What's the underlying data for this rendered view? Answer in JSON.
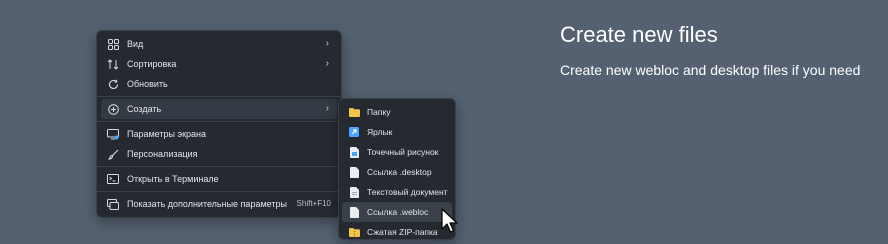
{
  "feature": {
    "title": "Create new files",
    "description": "Create new webloc and desktop files if you need"
  },
  "context_menu": {
    "items": [
      {
        "label": "Вид",
        "icon": "grid-icon",
        "has_submenu": true
      },
      {
        "label": "Сортировка",
        "icon": "sort-icon",
        "has_submenu": true
      },
      {
        "label": "Обновить",
        "icon": "refresh-icon",
        "has_submenu": false
      },
      {
        "label": "Создать",
        "icon": "plus-circle-icon",
        "has_submenu": true
      },
      {
        "label": "Параметры экрана",
        "icon": "display-icon",
        "has_submenu": false
      },
      {
        "label": "Персонализация",
        "icon": "brush-icon",
        "has_submenu": false
      },
      {
        "label": "Открыть в Терминале",
        "icon": "terminal-icon",
        "has_submenu": false
      },
      {
        "label": "Показать дополнительные параметры",
        "icon": "more-options-icon",
        "shortcut": "Shift+F10"
      }
    ]
  },
  "new_submenu": {
    "items": [
      {
        "label": "Папку",
        "icon": "folder-icon"
      },
      {
        "label": "Ярлык",
        "icon": "shortcut-icon"
      },
      {
        "label": "Точечный рисунок",
        "icon": "bitmap-file-icon"
      },
      {
        "label": "Ссылка .desktop",
        "icon": "desktop-file-icon"
      },
      {
        "label": "Текстовый документ",
        "icon": "text-file-icon"
      },
      {
        "label": "Ссылка .webloc",
        "icon": "webloc-file-icon"
      },
      {
        "label": "Сжатая ZIP-папка",
        "icon": "zip-folder-icon"
      }
    ]
  },
  "colors": {
    "background": "#556171",
    "menu": "#252a31",
    "folder": "#f3c24a",
    "accent": "#4aa3ff"
  }
}
